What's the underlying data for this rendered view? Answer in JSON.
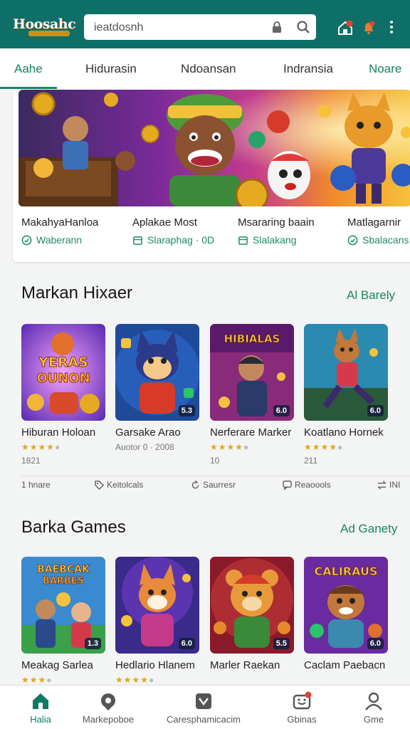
{
  "header": {
    "logo_text": "Hoosahc",
    "search_text": "ieatdosnh",
    "colors": {
      "bar": "#0e6f68",
      "accent": "#168859",
      "badge": "#e3412f"
    },
    "icons": [
      "lock-icon",
      "search-icon",
      "home-notification-icon",
      "bell-icon",
      "more-vert-icon"
    ]
  },
  "tabs": [
    {
      "label": "Aahe",
      "active": true
    },
    {
      "label": "Hidurasin"
    },
    {
      "label": "Ndoansan"
    },
    {
      "label": "Indransia"
    },
    {
      "label": "Noare"
    }
  ],
  "hero": {
    "items": [
      {
        "title": "MakahyaHanloa",
        "status": "Waberann",
        "icon": "shield-icon"
      },
      {
        "title": "Aplakae Most",
        "status": "Slaraphag · 0D",
        "icon": "calendar-icon"
      },
      {
        "title": "Msararing baain",
        "status": "Slalakang",
        "icon": "calendar-icon"
      },
      {
        "title": "Matlagarnir",
        "status": "Sbalacans",
        "icon": "shield-icon"
      }
    ]
  },
  "section1": {
    "title": "Markan Hixaer",
    "link": "Al Barely",
    "games": [
      {
        "name": "Hiburan Holoan",
        "stars": 4,
        "sub": "1821",
        "badge": "",
        "art": "YERAS OUNON"
      },
      {
        "name": "Garsake Arao",
        "stars": 0,
        "sub": "Auotor 0 · 2008",
        "badge": "5.3",
        "art": ""
      },
      {
        "name": "Nerferare Marker",
        "stars": 4,
        "sub": "10",
        "badge": "6.0",
        "art": "HIBIALAS"
      },
      {
        "name": "Koatlano Hornek",
        "stars": 4,
        "sub": "211",
        "badge": "6.0",
        "art": ""
      }
    ]
  },
  "filters": [
    {
      "label": "1 hnare",
      "icon": ""
    },
    {
      "label": "Keitolcals",
      "icon": "tag-icon"
    },
    {
      "label": "Saurresr",
      "icon": "refresh-icon"
    },
    {
      "label": "Reaoools",
      "icon": "chat-icon"
    },
    {
      "label": "INI",
      "icon": "swap-icon"
    }
  ],
  "section2": {
    "title": "Barka Games",
    "link": "Ad Ganety",
    "games": [
      {
        "name": "Meakag Sarlea",
        "stars": 3,
        "badge": "1.3",
        "art": "BAEBCAK BARBES"
      },
      {
        "name": "Hedlario Hlanem",
        "stars": 4,
        "badge": "6.0",
        "art": ""
      },
      {
        "name": "Marler Raekan",
        "stars": 0,
        "badge": "5.5",
        "art": ""
      },
      {
        "name": "Caclam Paebacn",
        "stars": 0,
        "badge": "6.0",
        "art": "CALIRAUS"
      }
    ]
  },
  "bottom_nav": [
    {
      "label": "Halia",
      "icon": "home-icon",
      "active": true
    },
    {
      "label": "Markepoboe",
      "icon": "marketplace-icon"
    },
    {
      "label": "Caresphamicacim",
      "icon": "category-icon"
    },
    {
      "label": "Gbinas",
      "icon": "gamepad-icon",
      "badge": true
    },
    {
      "label": "Gme",
      "icon": "person-icon"
    }
  ]
}
